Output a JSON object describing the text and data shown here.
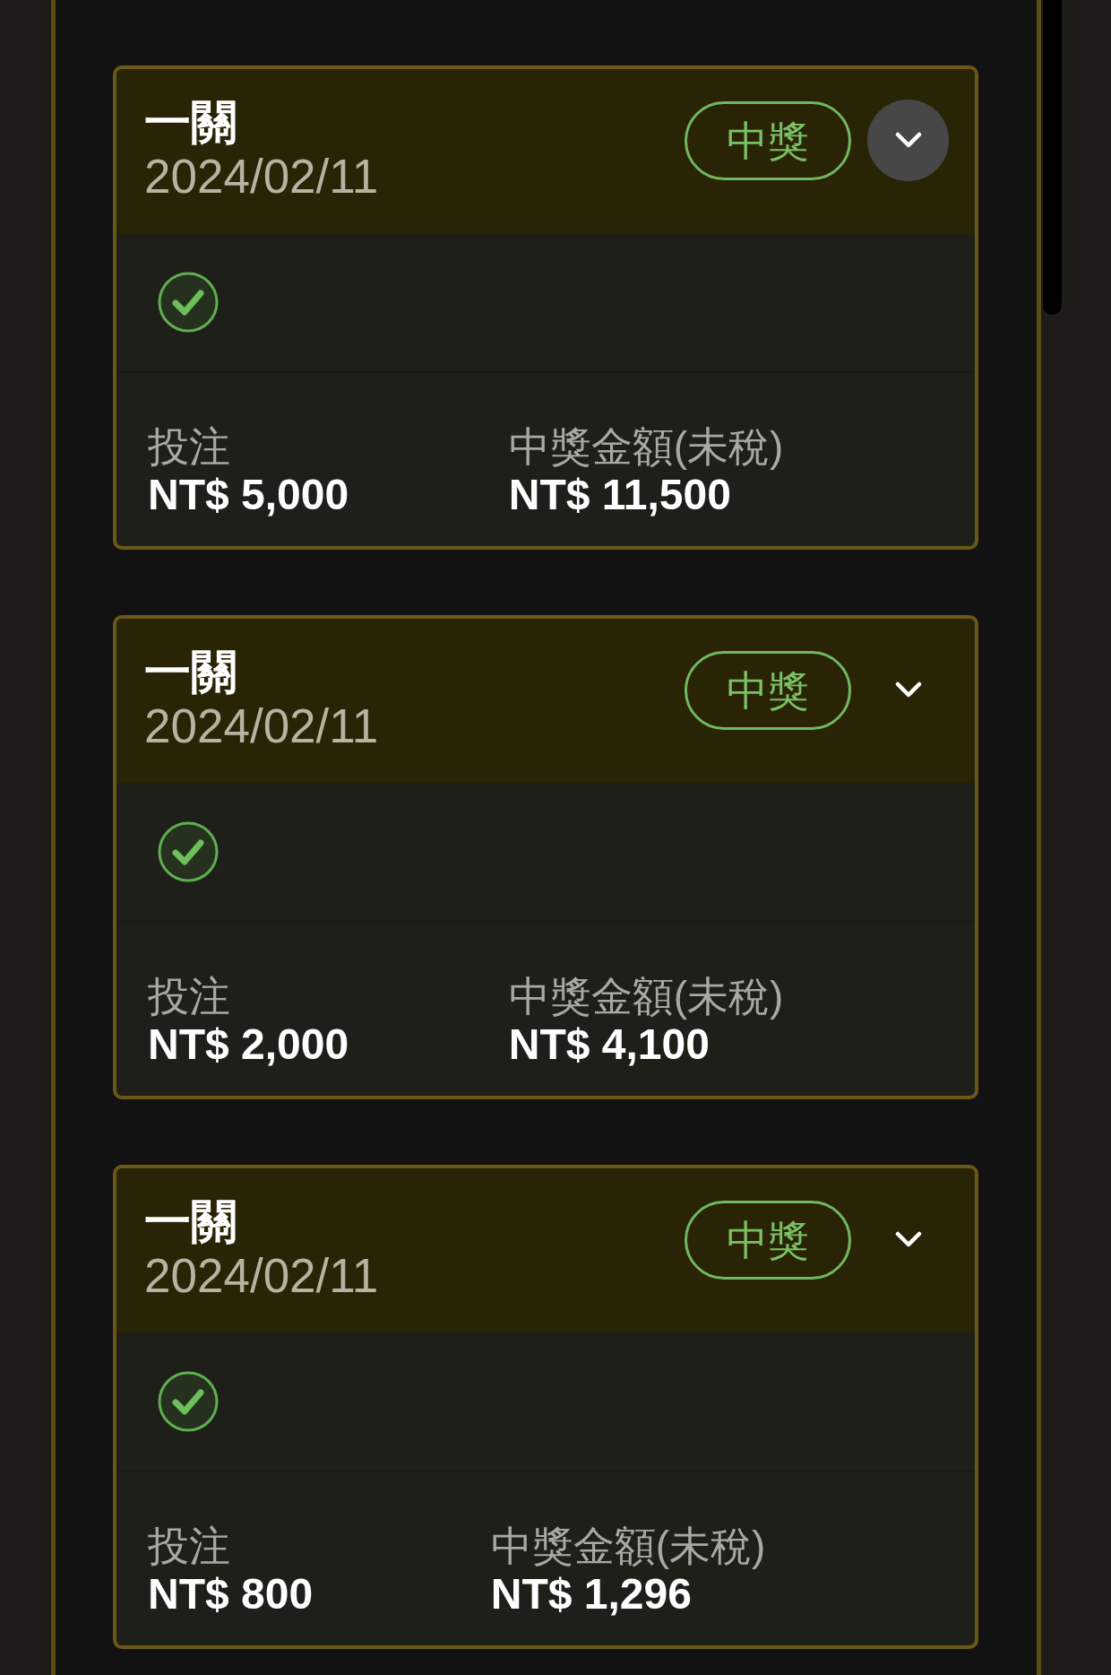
{
  "cards": [
    {
      "title": "一關",
      "date": "2024/02/11",
      "badge": "中獎",
      "expand_button": {
        "highlighted": true,
        "expanded": false
      },
      "legs": [
        {
          "won": true
        }
      ],
      "stake": {
        "label": "投注",
        "value": "NT$ 5,000"
      },
      "payout": {
        "label": "中獎金額(未稅)",
        "value": "NT$ 11,500"
      }
    },
    {
      "title": "一關",
      "date": "2024/02/11",
      "badge": "中獎",
      "expand_button": {
        "highlighted": false,
        "expanded": false
      },
      "legs": [
        {
          "won": true
        }
      ],
      "stake": {
        "label": "投注",
        "value": "NT$ 2,000"
      },
      "payout": {
        "label": "中獎金額(未稅)",
        "value": "NT$ 4,100"
      }
    },
    {
      "title": "一關",
      "date": "2024/02/11",
      "badge": "中獎",
      "expand_button": {
        "highlighted": false,
        "expanded": false
      },
      "legs": [
        {
          "won": true
        }
      ],
      "stake": {
        "label": "投注",
        "value": "NT$ 800"
      },
      "payout": {
        "label": "中獎金額(未稅)",
        "value": "NT$ 1,296"
      }
    }
  ]
}
